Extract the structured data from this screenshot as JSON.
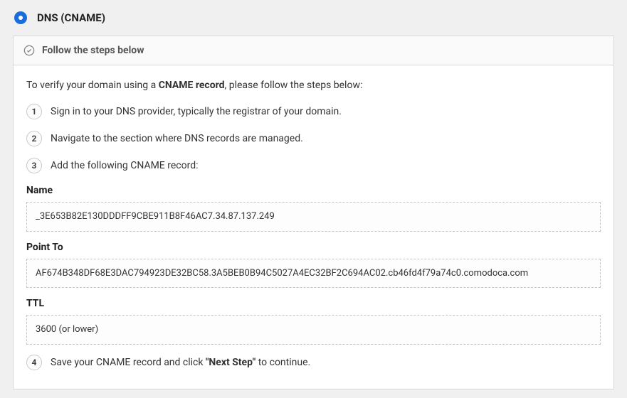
{
  "header": {
    "title": "DNS (CNAME)"
  },
  "panel": {
    "header_text": "Follow the steps below"
  },
  "intro": {
    "prefix": "To verify your domain using a ",
    "bold": "CNAME record",
    "suffix": ", please follow the steps below:"
  },
  "steps": {
    "s1": {
      "num": "1",
      "text": "Sign in to your DNS provider, typically the registrar of your domain."
    },
    "s2": {
      "num": "2",
      "text": "Navigate to the section where DNS records are managed."
    },
    "s3": {
      "num": "3",
      "text": "Add the following CNAME record:"
    },
    "s4": {
      "num": "4",
      "prefix": "Save your CNAME record and click ",
      "bold": "\"Next Step\"",
      "suffix": " to continue."
    }
  },
  "fields": {
    "name": {
      "label": "Name",
      "value": "_3E653B82E130DDDFF9CBE911B8F46AC7.34.87.137.249"
    },
    "point_to": {
      "label": "Point To",
      "value": "AF674B348DF68E3DAC794923DE32BC58.3A5BEB0B94C5027A4EC32BF2C694AC02.cb46fd4f79a74c0.comodoca.com"
    },
    "ttl": {
      "label": "TTL",
      "value": "3600 (or lower)"
    }
  }
}
